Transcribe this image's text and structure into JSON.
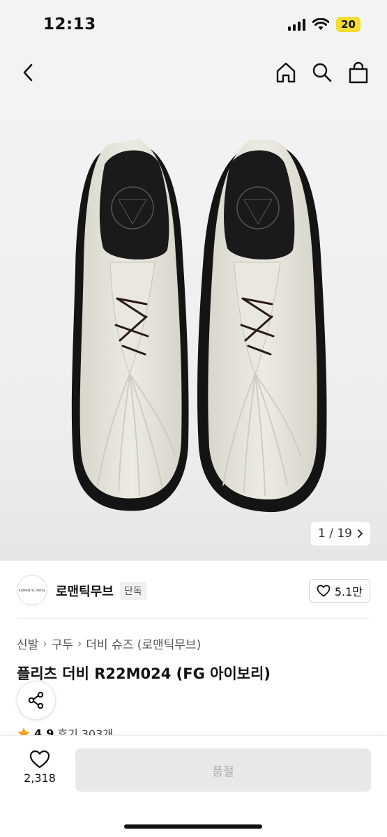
{
  "status_bar": {
    "time": "12:13",
    "battery": "20"
  },
  "gallery": {
    "counter": "1 / 19"
  },
  "brand": {
    "name": "로맨틱무브",
    "tag": "단독",
    "logo_text": "ROMANTIC MOVE",
    "likes": "5.1만"
  },
  "breadcrumb": {
    "items": [
      "신발",
      "구두",
      "더비 슈즈 (로맨틱무브)"
    ]
  },
  "product": {
    "title": "플리츠 더비 R22M024 (FG 아이보리)",
    "rating": "4.9",
    "review_label": "후기 303개"
  },
  "bottom": {
    "wish_count": "2,318",
    "buy_label": "품절"
  },
  "colors": {
    "accent_star": "#f5a623",
    "battery": "#f5dc35",
    "disabled_button": "#e8e8e8"
  },
  "icons": [
    "back-icon",
    "home-icon",
    "search-icon",
    "shopping-bag-icon",
    "heart-icon",
    "share-icon",
    "star-icon",
    "chevron-right-icon"
  ]
}
